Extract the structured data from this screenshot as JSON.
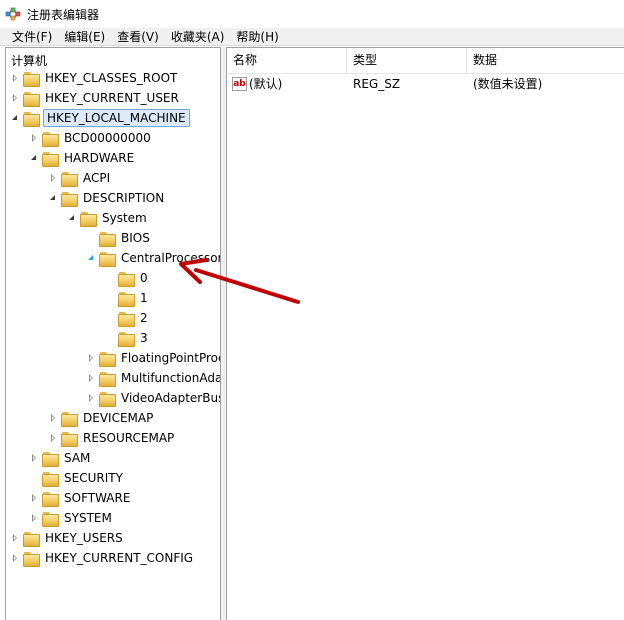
{
  "window": {
    "title": "注册表编辑器"
  },
  "menu": [
    "文件(F)",
    "编辑(E)",
    "查看(V)",
    "收藏夹(A)",
    "帮助(H)"
  ],
  "tree": {
    "root": "计算机",
    "nodes": [
      {
        "label": "HKEY_CLASSES_ROOT",
        "state": "closed",
        "level": 0
      },
      {
        "label": "HKEY_CURRENT_USER",
        "state": "closed",
        "level": 0
      },
      {
        "label": "HKEY_LOCAL_MACHINE",
        "state": "open",
        "level": 0,
        "selected": true
      },
      {
        "label": "BCD00000000",
        "state": "closed",
        "level": 1
      },
      {
        "label": "HARDWARE",
        "state": "open",
        "level": 1
      },
      {
        "label": "ACPI",
        "state": "closed",
        "level": 2
      },
      {
        "label": "DESCRIPTION",
        "state": "open",
        "level": 2
      },
      {
        "label": "System",
        "state": "open",
        "level": 3
      },
      {
        "label": "BIOS",
        "state": "none",
        "level": 4
      },
      {
        "label": "CentralProcessor",
        "state": "open-blue",
        "level": 4
      },
      {
        "label": "0",
        "state": "none",
        "level": 5
      },
      {
        "label": "1",
        "state": "none",
        "level": 5
      },
      {
        "label": "2",
        "state": "none",
        "level": 5
      },
      {
        "label": "3",
        "state": "none",
        "level": 5
      },
      {
        "label": "FloatingPointProces",
        "state": "closed",
        "level": 4
      },
      {
        "label": "MultifunctionAdapte",
        "state": "closed",
        "level": 4
      },
      {
        "label": "VideoAdapterBusse",
        "state": "closed",
        "level": 4
      },
      {
        "label": "DEVICEMAP",
        "state": "closed",
        "level": 2
      },
      {
        "label": "RESOURCEMAP",
        "state": "closed",
        "level": 2
      },
      {
        "label": "SAM",
        "state": "closed",
        "level": 1
      },
      {
        "label": "SECURITY",
        "state": "none",
        "level": 1
      },
      {
        "label": "SOFTWARE",
        "state": "closed",
        "level": 1
      },
      {
        "label": "SYSTEM",
        "state": "closed",
        "level": 1
      },
      {
        "label": "HKEY_USERS",
        "state": "closed",
        "level": 0
      },
      {
        "label": "HKEY_CURRENT_CONFIG",
        "state": "closed",
        "level": 0
      }
    ]
  },
  "list": {
    "columns": [
      "名称",
      "类型",
      "数据"
    ],
    "rows": [
      {
        "icon": "string-value-icon",
        "icon_text": "ab",
        "name": "(默认)",
        "type": "REG_SZ",
        "data": "(数值未设置)"
      }
    ]
  },
  "colors": {
    "arrow": "#c00000",
    "selection": "#dceaf9"
  }
}
